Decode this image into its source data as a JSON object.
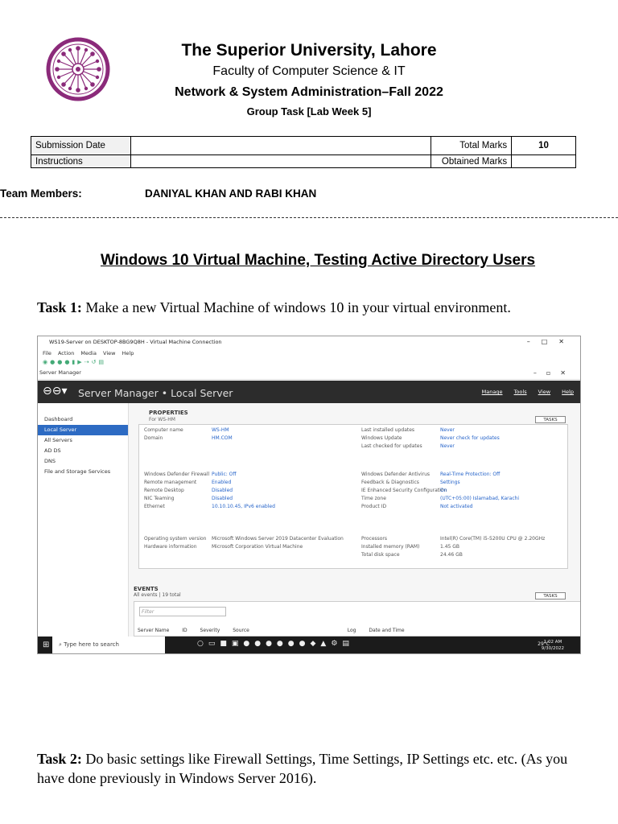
{
  "header": {
    "university": "The Superior University, Lahore",
    "faculty": "Faculty of Computer Science & IT",
    "course": "Network & System Administration–Fall 2022",
    "task_title": "Group Task [Lab Week 5]"
  },
  "info_table": {
    "submission_date_label": "Submission Date",
    "instructions_label": "Instructions",
    "total_marks_label": "Total Marks",
    "total_marks_value": "10",
    "obtained_marks_label": "Obtained Marks"
  },
  "team": {
    "label": "Team Members:",
    "names": "DANIYAL KHAN AND RABI KHAN"
  },
  "doc_title": "Windows 10 Virtual Machine, Testing Active Directory Users",
  "task1": {
    "label": "Task 1:",
    "text": " Make a new Virtual Machine of windows 10 in your virtual environment."
  },
  "task2": {
    "label": "Task 2:",
    "text": " Do basic settings like Firewall Settings, Time Settings, IP Settings etc. etc. (As you have done previously in Windows Server 2016)."
  },
  "screenshot": {
    "vm_title": "WS19-Server on DESKTOP-8BG9Q8H - Virtual Machine Connection",
    "vm_menu": [
      "File",
      "Action",
      "Media",
      "View",
      "Help"
    ],
    "sm_title": "Server Manager",
    "crumb": "Server Manager • Local Server",
    "bar_right": [
      "Manage",
      "Tools",
      "View",
      "Help"
    ],
    "sidebar": [
      "Dashboard",
      "Local Server",
      "All Servers",
      "AD DS",
      "DNS",
      "File and Storage Services"
    ],
    "properties_title": "PROPERTIES",
    "properties_sub": "For WS-HM",
    "tasks_label": "TASKS",
    "props_left": [
      {
        "k": "Computer name",
        "v": "WS-HM"
      },
      {
        "k": "Domain",
        "v": "HM.COM"
      },
      {
        "k": "Windows Defender Firewall",
        "v": "Public: Off"
      },
      {
        "k": "Remote management",
        "v": "Enabled"
      },
      {
        "k": "Remote Desktop",
        "v": "Disabled"
      },
      {
        "k": "NIC Teaming",
        "v": "Disabled"
      },
      {
        "k": "Ethernet",
        "v": "10.10.10.45, IPv6 enabled"
      },
      {
        "k": "Operating system version",
        "v": "Microsoft Windows Server 2019 Datacenter Evaluation"
      },
      {
        "k": "Hardware information",
        "v": "Microsoft Corporation Virtual Machine"
      }
    ],
    "props_right": [
      {
        "k": "Last installed updates",
        "v": "Never"
      },
      {
        "k": "Windows Update",
        "v": "Never check for updates"
      },
      {
        "k": "Last checked for updates",
        "v": "Never"
      },
      {
        "k": "Windows Defender Antivirus",
        "v": "Real-Time Protection: Off"
      },
      {
        "k": "Feedback & Diagnostics",
        "v": "Settings"
      },
      {
        "k": "IE Enhanced Security Configuration",
        "v": "On"
      },
      {
        "k": "Time zone",
        "v": "(UTC+05:00) Islamabad, Karachi"
      },
      {
        "k": "Product ID",
        "v": "Not activated"
      },
      {
        "k": "Processors",
        "v": "Intel(R) Core(TM) i5-5200U CPU @ 2.20GHz"
      },
      {
        "k": "Installed memory (RAM)",
        "v": "1.45 GB"
      },
      {
        "k": "Total disk space",
        "v": "24.46 GB"
      }
    ],
    "events_title": "EVENTS",
    "events_sub": "All events | 19 total",
    "filter_placeholder": "Filter",
    "event_cols": [
      "Server Name",
      "ID",
      "Severity",
      "Source",
      "Log",
      "Date and Time"
    ],
    "search_placeholder": "Type here to search",
    "tray_temp": "29°C",
    "clock_time": "1:02 AM",
    "clock_date": "9/30/2022"
  }
}
